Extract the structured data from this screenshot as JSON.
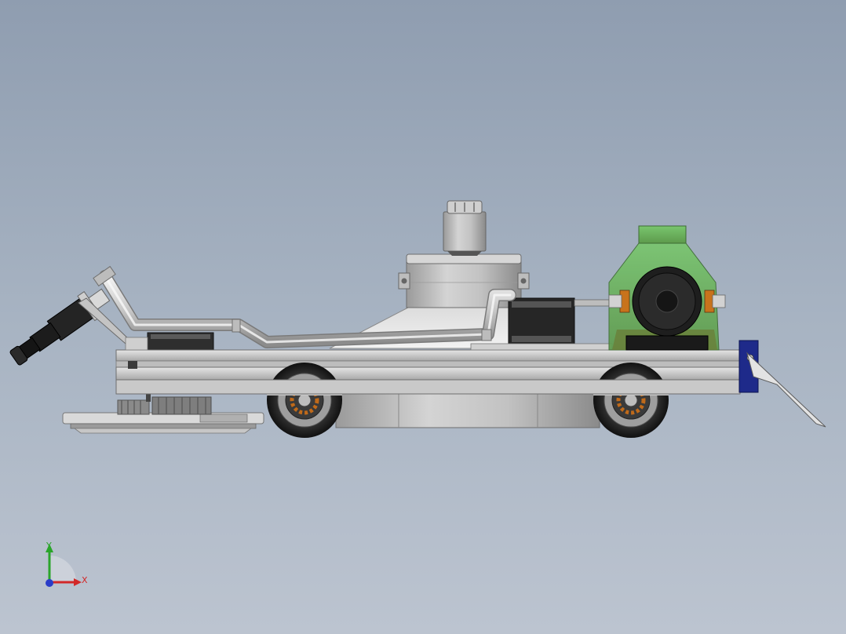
{
  "viewport": {
    "background_top": "#8f9db0",
    "background_bottom": "#bcc4d0"
  },
  "model": {
    "components": [
      "suction-nozzle",
      "vacuum-pipe",
      "main-blower-housing",
      "top-motor",
      "stepper-motor-left",
      "stepper-motor-right",
      "pump-motor",
      "green-tank",
      "chassis-frame",
      "front-wheel",
      "rear-wheel",
      "cleaning-brush-disc",
      "gear-train",
      "rear-squeegee-blade",
      "blue-mount-bracket"
    ]
  },
  "triad": {
    "y_label": "Y",
    "x_label": "X",
    "y_color": "#2aa52a",
    "x_color": "#d22828",
    "z_color": "#2a3cc8"
  }
}
